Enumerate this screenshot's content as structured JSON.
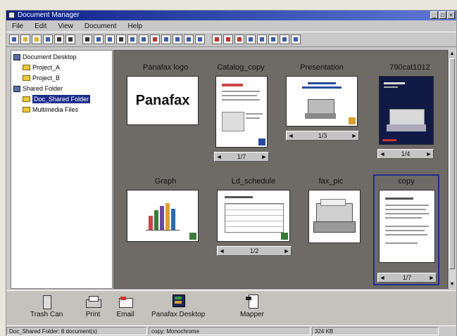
{
  "window": {
    "title": "Document Manager"
  },
  "menu": [
    "File",
    "Edit",
    "View",
    "Document",
    "Help"
  ],
  "tree": {
    "items": [
      {
        "label": "Document Desktop",
        "icon": "desktop-icon"
      },
      {
        "label": "Project_A",
        "icon": "folder-icon"
      },
      {
        "label": "Project_B",
        "icon": "folder-icon"
      },
      {
        "label": "Shared Folder",
        "icon": "shared-folder-icon"
      },
      {
        "label": "Doc_Shared Folder",
        "icon": "folder-icon",
        "selected": true
      },
      {
        "label": "Multimedia Files",
        "icon": "folder-icon"
      }
    ]
  },
  "documents": [
    {
      "label": "Panafax logo",
      "logo_text": "Panafax"
    },
    {
      "label": "Catalog_copy",
      "pager": "1/7"
    },
    {
      "label": "Presentation",
      "pager": "1/3"
    },
    {
      "label": "790cat1012",
      "pager": "1/4"
    },
    {
      "label": "Graph"
    },
    {
      "label": "Ld_schedule",
      "pager": "1/2"
    },
    {
      "label": "fax_pic"
    },
    {
      "label": "copy",
      "pager": "1/7",
      "selected": true
    }
  ],
  "bottom_buttons": [
    {
      "label": "Trash Can",
      "icon": "trash-can-icon"
    },
    {
      "label": "Print",
      "icon": "printer-icon"
    },
    {
      "label": "Email",
      "icon": "email-icon"
    },
    {
      "label": "Panafax Desktop",
      "icon": "panafax-desktop-icon"
    },
    {
      "label": "Mapper",
      "icon": "mapper-icon"
    }
  ],
  "status": {
    "left": "Doc_Shared Folder: 8 document(s)",
    "middle": "copy: Monochrome",
    "right": "324 KB"
  }
}
